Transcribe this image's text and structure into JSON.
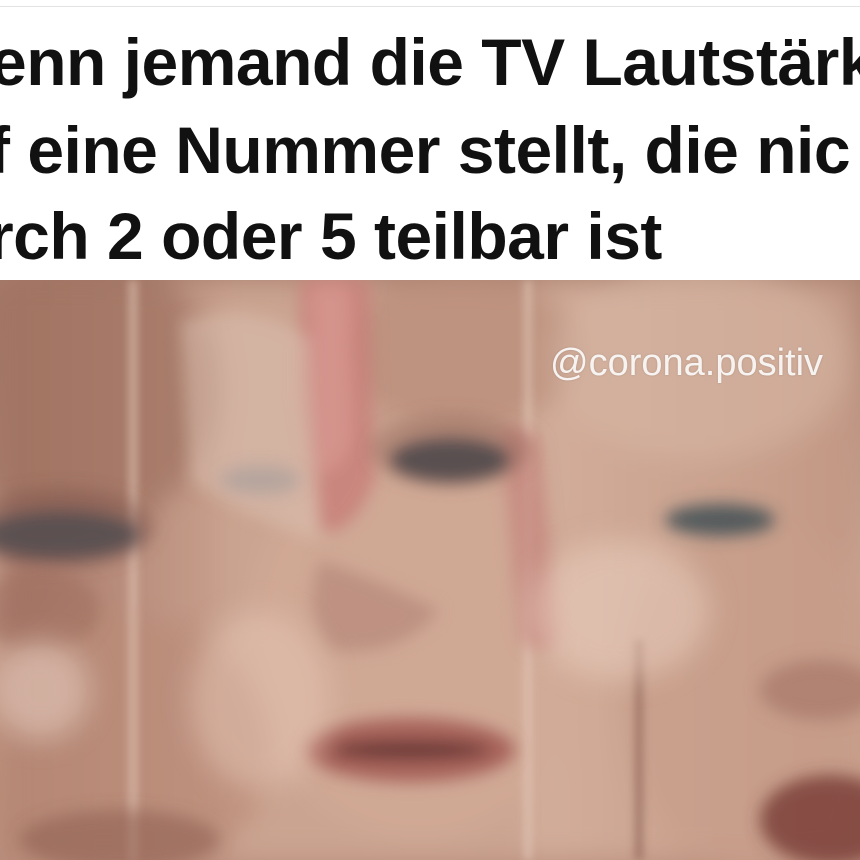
{
  "caption": {
    "line1": "enn jemand die TV Lautstärk",
    "line2": "f eine Nummer stellt, die nic",
    "line3": "rch 2 oder 5 teilbar ist"
  },
  "photo": {
    "watermark": "@corona.positiv",
    "description_colors": {
      "skin": "#c9a08d",
      "skin_shadow": "#9b6e5e",
      "lips": "#a8625a",
      "eyes": "#2c3f4f",
      "finger": "#c47f7a"
    }
  }
}
